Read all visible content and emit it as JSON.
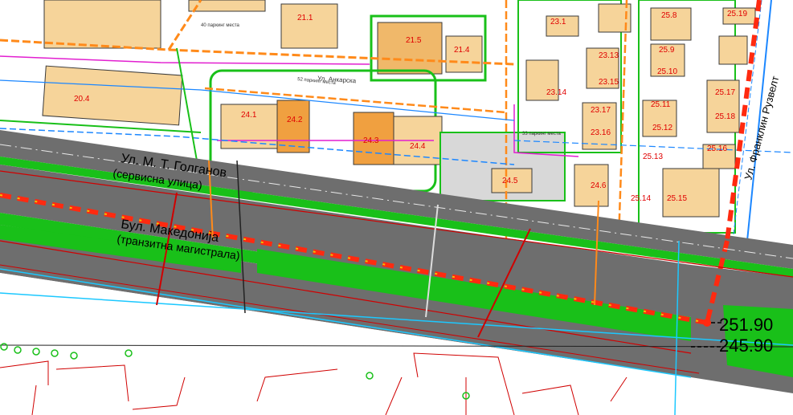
{
  "map": {
    "street_labels": {
      "service_street_name": "Ул. М. Т. Голганов",
      "service_street_type": "(сервисна улица)",
      "main_boulevard_name": "Бул. Македонија",
      "main_boulevard_type": "(транзитна магистрала)",
      "right_boulevard_fragment": "Ул. Франклин Рузвелт",
      "inner_street_fragment": "Ул. Анкарска"
    },
    "elevations": {
      "upper": "251.90",
      "lower": "245.90"
    },
    "parcels": [
      "20.4",
      "21.1",
      "21.5",
      "21.4",
      "24.1",
      "24.2",
      "24.3",
      "24.4",
      "24.5",
      "24.6",
      "23.1",
      "23.13",
      "23.14",
      "23.15",
      "23.16",
      "23.17",
      "25.8",
      "25.9",
      "25.10",
      "25.11",
      "25.12",
      "25.13",
      "25.14",
      "25.15",
      "25.16",
      "25.17",
      "25.18",
      "25.19"
    ],
    "parking_notes": {
      "parking_1": "40 паркинг места",
      "parking_2": "52 паркинг места",
      "parking_3": "33 паркинг места"
    },
    "colors": {
      "road_asphalt": "#6e6e6e",
      "green_strip": "#19c019",
      "building_fill": "#f6d49a",
      "parcel_label": "#e00000",
      "dashed_axis": "#ff2a10",
      "utility_orange": "#ff8a1a",
      "utility_magenta": "#e21fd0",
      "utility_blue": "#1c87ff"
    }
  }
}
